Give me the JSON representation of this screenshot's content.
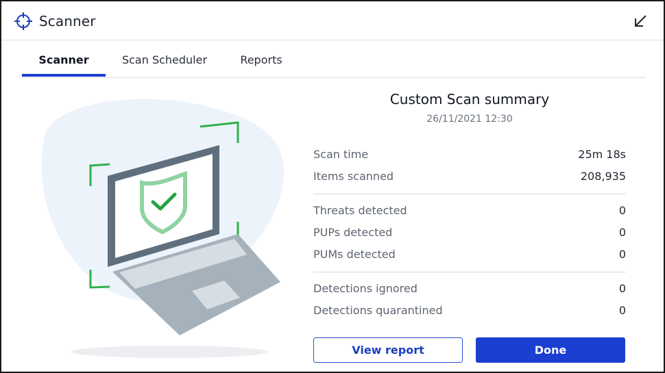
{
  "app": {
    "title": "Scanner",
    "icon": "crosshair-icon",
    "minimize_icon": "arrow-down-left-icon"
  },
  "tabs": [
    {
      "label": "Scanner",
      "active": true
    },
    {
      "label": "Scan Scheduler",
      "active": false
    },
    {
      "label": "Reports",
      "active": false
    }
  ],
  "illustration": {
    "icon": "laptop-shield-check-icon",
    "colors": {
      "blob": "#edf3fb",
      "bracket": "#2fb14b",
      "laptop": "#5f6f7e",
      "shield": "#8fd3a2",
      "check": "#25a244"
    }
  },
  "summary": {
    "title": "Custom Scan summary",
    "date": "26/11/2021 12:30",
    "rows": [
      {
        "label": "Scan time",
        "value": "25m 18s"
      },
      {
        "label": "Items scanned",
        "value": "208,935"
      },
      {
        "label": "Threats detected",
        "value": "0"
      },
      {
        "label": "PUPs detected",
        "value": "0"
      },
      {
        "label": "PUMs detected",
        "value": "0"
      },
      {
        "label": "Detections ignored",
        "value": "0"
      },
      {
        "label": "Detections quarantined",
        "value": "0"
      }
    ]
  },
  "buttons": {
    "view_report": "View report",
    "done": "Done"
  },
  "colors": {
    "accent": "#1b3fd0",
    "tab_underline": "#1a3fcf"
  }
}
